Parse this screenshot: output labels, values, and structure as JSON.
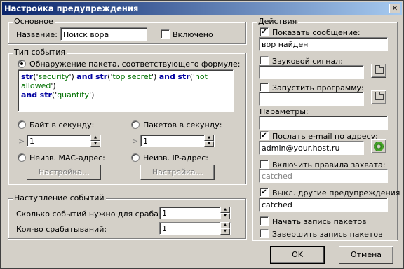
{
  "window": {
    "title": "Настройка предупреждения",
    "close_glyph": "✕"
  },
  "basic": {
    "group_title": "Основное",
    "name_label": "Название:",
    "name_value": "Поиск вора",
    "enabled_label": "Включено",
    "enabled_checked": false
  },
  "event_type": {
    "group_title": "Тип события",
    "formula_radio_label": "Обнаружение пакета, соответствующего формуле:",
    "formula_radio_selected": true,
    "formula_tokens": [
      {
        "t": "str",
        "c": "kw"
      },
      {
        "t": "('",
        "c": "ok"
      },
      {
        "t": "security",
        "c": "st"
      },
      {
        "t": "') ",
        "c": "ok"
      },
      {
        "t": "and",
        "c": "kw"
      },
      {
        "t": " ",
        "c": "ok"
      },
      {
        "t": "str",
        "c": "kw"
      },
      {
        "t": "('",
        "c": "ok"
      },
      {
        "t": "top secret",
        "c": "st"
      },
      {
        "t": "') ",
        "c": "ok"
      },
      {
        "t": "and",
        "c": "kw"
      },
      {
        "t": " ",
        "c": "ok"
      },
      {
        "t": "str",
        "c": "kw"
      },
      {
        "t": "('",
        "c": "ok"
      },
      {
        "t": "not allowed",
        "c": "st"
      },
      {
        "t": "')",
        "c": "ok"
      },
      {
        "t": "\n",
        "c": "ok"
      },
      {
        "t": "and",
        "c": "kw"
      },
      {
        "t": " ",
        "c": "ok"
      },
      {
        "t": "str",
        "c": "kw"
      },
      {
        "t": "('",
        "c": "ok"
      },
      {
        "t": "quantity",
        "c": "st"
      },
      {
        "t": "')",
        "c": "ok"
      }
    ],
    "bytes_label": "Байт в секунду:",
    "packets_label": "Пакетов в секунду:",
    "gt_symbol": ">",
    "bytes_value": "1",
    "packets_value": "1",
    "unknown_mac_label": "Неизв. MAC-адрес:",
    "unknown_ip_label": "Неизв. IP-адрес:",
    "settings_button": "Настройка..."
  },
  "occurrence": {
    "group_title": "Наступление событий",
    "events_needed_label": "Сколько событий нужно для срабат.:",
    "events_needed_value": "1",
    "trigger_count_label": "Кол-во срабатываний:",
    "trigger_count_value": "1"
  },
  "actions": {
    "group_title": "Действия",
    "show_message_label": "Показать сообщение:",
    "show_message_checked": true,
    "message_value": "вор найден",
    "sound_label": "Звуковой сигнал:",
    "sound_checked": false,
    "sound_value": "",
    "run_program_label": "Запустить программу:",
    "run_program_checked": false,
    "program_value": "",
    "params_label": "Параметры:",
    "params_value": "",
    "email_label": "Послать e-mail по адресу:",
    "email_checked": true,
    "email_value": "admin@your.host.ru",
    "capture_rules_label": "Включить правила захвата:",
    "capture_rules_checked": false,
    "capture_rules_value": "catched",
    "disable_others_label": "Выкл. другие предупреждения",
    "disable_others_checked": true,
    "disable_others_value": "catched",
    "start_capture_label": "Начать запись пакетов",
    "start_capture_checked": false,
    "stop_capture_label": "Завершить запись пакетов",
    "stop_capture_checked": false
  },
  "footer": {
    "ok_label": "OK",
    "cancel_label": "Отмена"
  },
  "icons": {
    "folder": "folder-icon",
    "gear": "gear-icon"
  },
  "colors": {
    "titlebar": "#0a246a",
    "keyword": "#0000a0",
    "string": "#007000"
  }
}
